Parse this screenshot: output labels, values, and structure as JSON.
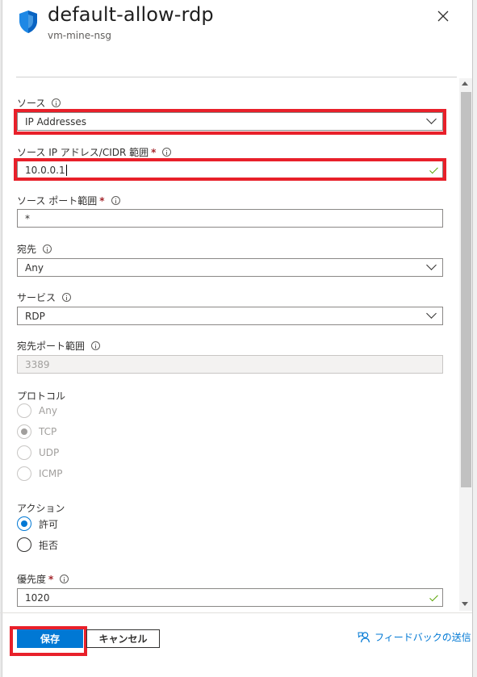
{
  "header": {
    "title": "default-allow-rdp",
    "subtitle": "vm-mine-nsg",
    "shield_icon": "shield-icon",
    "close_icon": "close-icon"
  },
  "form": {
    "source": {
      "label": "ソース",
      "value": "IP Addresses"
    },
    "source_ip": {
      "label": "ソース IP アドレス/CIDR 範囲",
      "required": "*",
      "value": "10.0.0.1"
    },
    "source_port": {
      "label": "ソース ポート範囲",
      "required": "*",
      "value": "*"
    },
    "destination": {
      "label": "宛先",
      "value": "Any"
    },
    "service": {
      "label": "サービス",
      "value": "RDP"
    },
    "dest_port": {
      "label": "宛先ポート範囲",
      "value": "3389"
    },
    "protocol": {
      "label": "プロトコル",
      "options": [
        "Any",
        "TCP",
        "UDP",
        "ICMP"
      ],
      "selected": "TCP"
    },
    "action": {
      "label": "アクション",
      "options": [
        "許可",
        "拒否"
      ],
      "selected": "許可"
    },
    "priority": {
      "label": "優先度",
      "required": "*",
      "value": "1020"
    }
  },
  "footer": {
    "save_label": "保存",
    "cancel_label": "キャンセル",
    "feedback_label": "フィードバックの送信"
  },
  "colors": {
    "accent": "#0078d4",
    "highlight": "#e8202a",
    "valid": "#57a300"
  }
}
